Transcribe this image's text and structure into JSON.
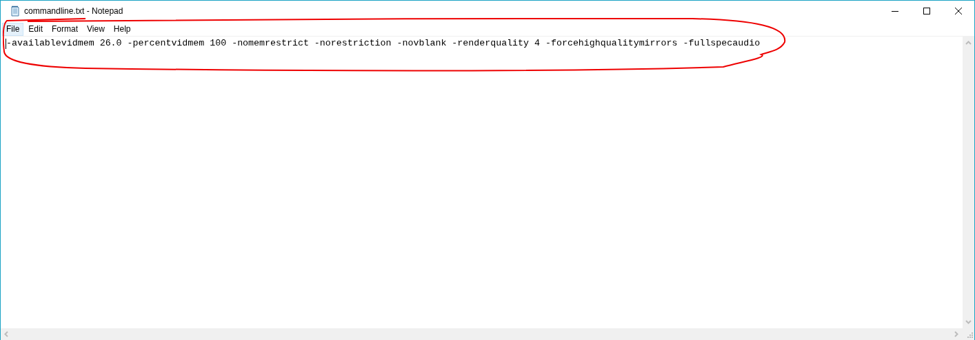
{
  "window": {
    "title": "commandline.txt - Notepad"
  },
  "menu": [
    {
      "label": "File",
      "selected": true
    },
    {
      "label": "Edit",
      "selected": false
    },
    {
      "label": "Format",
      "selected": false
    },
    {
      "label": "View",
      "selected": false
    },
    {
      "label": "Help",
      "selected": false
    }
  ],
  "editor": {
    "lines": [
      "-availablevidmem 26.0 -percentvidmem 100 -nomemrestrict -norestriction -novblank -renderquality 4 -forcehighqualitymirrors -fullspecaudio"
    ]
  }
}
